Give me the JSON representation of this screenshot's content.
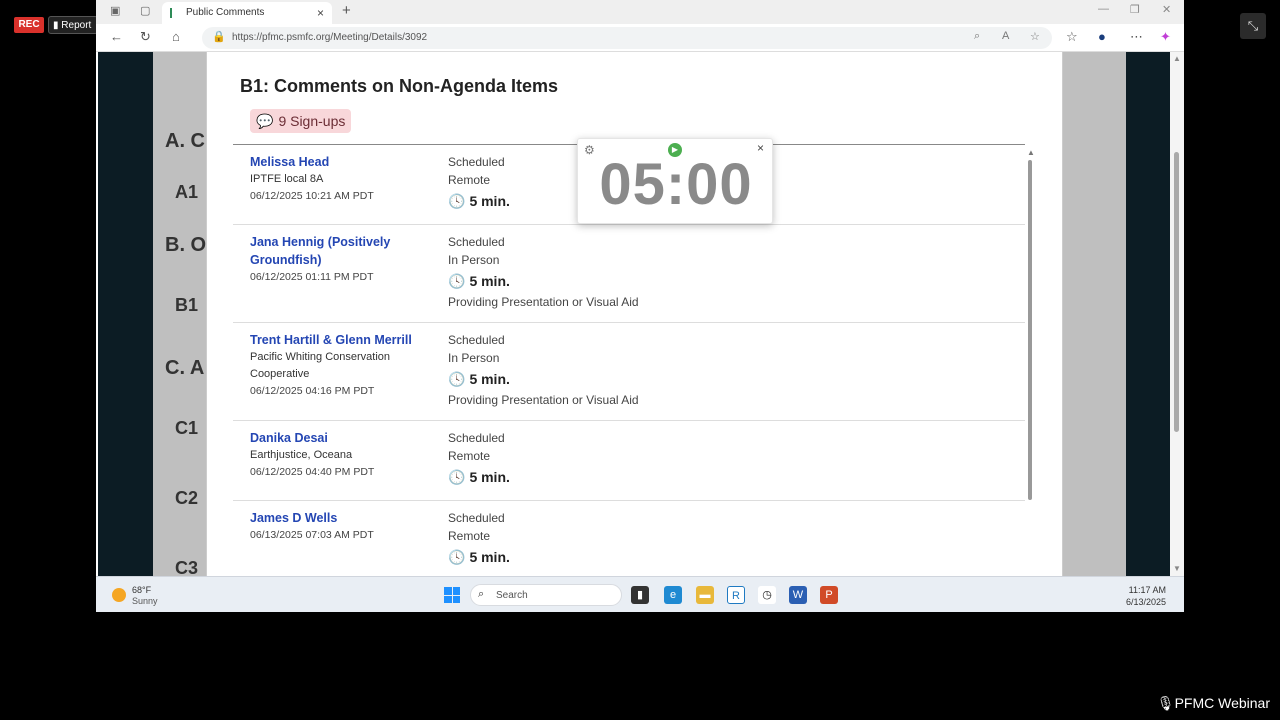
{
  "overlay": {
    "rec_label": "REC",
    "report_label": "Report",
    "collapse_glyph": "⤡",
    "webinar_label": "PFMC Webinar",
    "mic_glyph": "🎙"
  },
  "browser": {
    "tab_title": "Public Comments",
    "tab_close": "×",
    "new_tab": "+",
    "url": "https://pfmc.psmfc.org/Meeting/Details/3092",
    "icons": [
      "back-icon",
      "refresh-icon",
      "home-icon",
      "lock-icon",
      "zoom-icon",
      "read-aloud-icon",
      "favorite-icon",
      "favorites-icon",
      "profile-icon",
      "more-icon",
      "copilot-icon"
    ]
  },
  "background_doc": {
    "labels": [
      "A. C",
      "A1",
      "B. O",
      "B1",
      "C. A",
      "C1",
      "C2",
      "C3"
    ]
  },
  "panel": {
    "title": "B1: Comments on Non-Agenda Items",
    "signups_icon": "💬",
    "signups_label": "9 Sign-ups"
  },
  "commenters": [
    {
      "name": "Melissa Head",
      "org": "IPTFE local 8A",
      "date": "06/12/2025 10:21 AM PDT",
      "status": "Scheduled",
      "mode": "Remote",
      "duration": "5 min.",
      "extra": ""
    },
    {
      "name": "Jana Hennig (Positively Groundfish)",
      "org": "",
      "date": "06/12/2025 01:11 PM PDT",
      "status": "Scheduled",
      "mode": "In Person",
      "duration": "5 min.",
      "extra": "Providing Presentation or Visual Aid"
    },
    {
      "name": "Trent Hartill & Glenn Merrill",
      "org": "Pacific Whiting Conservation Cooperative",
      "date": "06/12/2025 04:16 PM PDT",
      "status": "Scheduled",
      "mode": "In Person",
      "duration": "5 min.",
      "extra": "Providing Presentation or Visual Aid"
    },
    {
      "name": "Danika Desai",
      "org": "Earthjustice, Oceana",
      "date": "06/12/2025 04:40 PM PDT",
      "status": "Scheduled",
      "mode": "Remote",
      "duration": "5 min.",
      "extra": ""
    },
    {
      "name": "James D Wells",
      "org": "",
      "date": "06/13/2025 07:03 AM PDT",
      "status": "Scheduled",
      "mode": "Remote",
      "duration": "5 min.",
      "extra": ""
    }
  ],
  "timer": {
    "value": "05:00",
    "gear": "⚙",
    "play": "▶",
    "close": "×"
  },
  "taskbar": {
    "temp": "68°F",
    "condition": "Sunny",
    "search_placeholder": "Search",
    "time": "11:17 AM",
    "date": "6/13/2025"
  },
  "colors": {
    "link": "#2446b3",
    "signup_bg": "#f8d7da",
    "timer_text": "#8a8a8a",
    "rec_red": "#d9312b"
  }
}
